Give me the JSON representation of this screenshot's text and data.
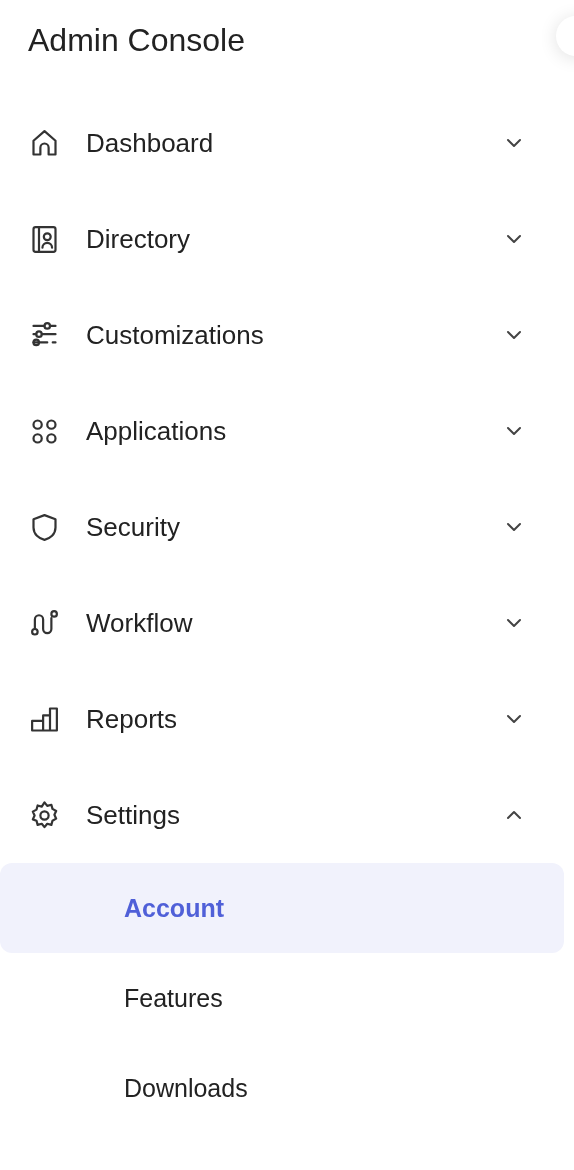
{
  "title": "Admin Console",
  "nav": [
    {
      "label": "Dashboard",
      "expanded": false
    },
    {
      "label": "Directory",
      "expanded": false
    },
    {
      "label": "Customizations",
      "expanded": false
    },
    {
      "label": "Applications",
      "expanded": false
    },
    {
      "label": "Security",
      "expanded": false
    },
    {
      "label": "Workflow",
      "expanded": false
    },
    {
      "label": "Reports",
      "expanded": false
    },
    {
      "label": "Settings",
      "expanded": true,
      "children": [
        {
          "label": "Account",
          "selected": true
        },
        {
          "label": "Features",
          "selected": false
        },
        {
          "label": "Downloads",
          "selected": false
        }
      ]
    }
  ]
}
